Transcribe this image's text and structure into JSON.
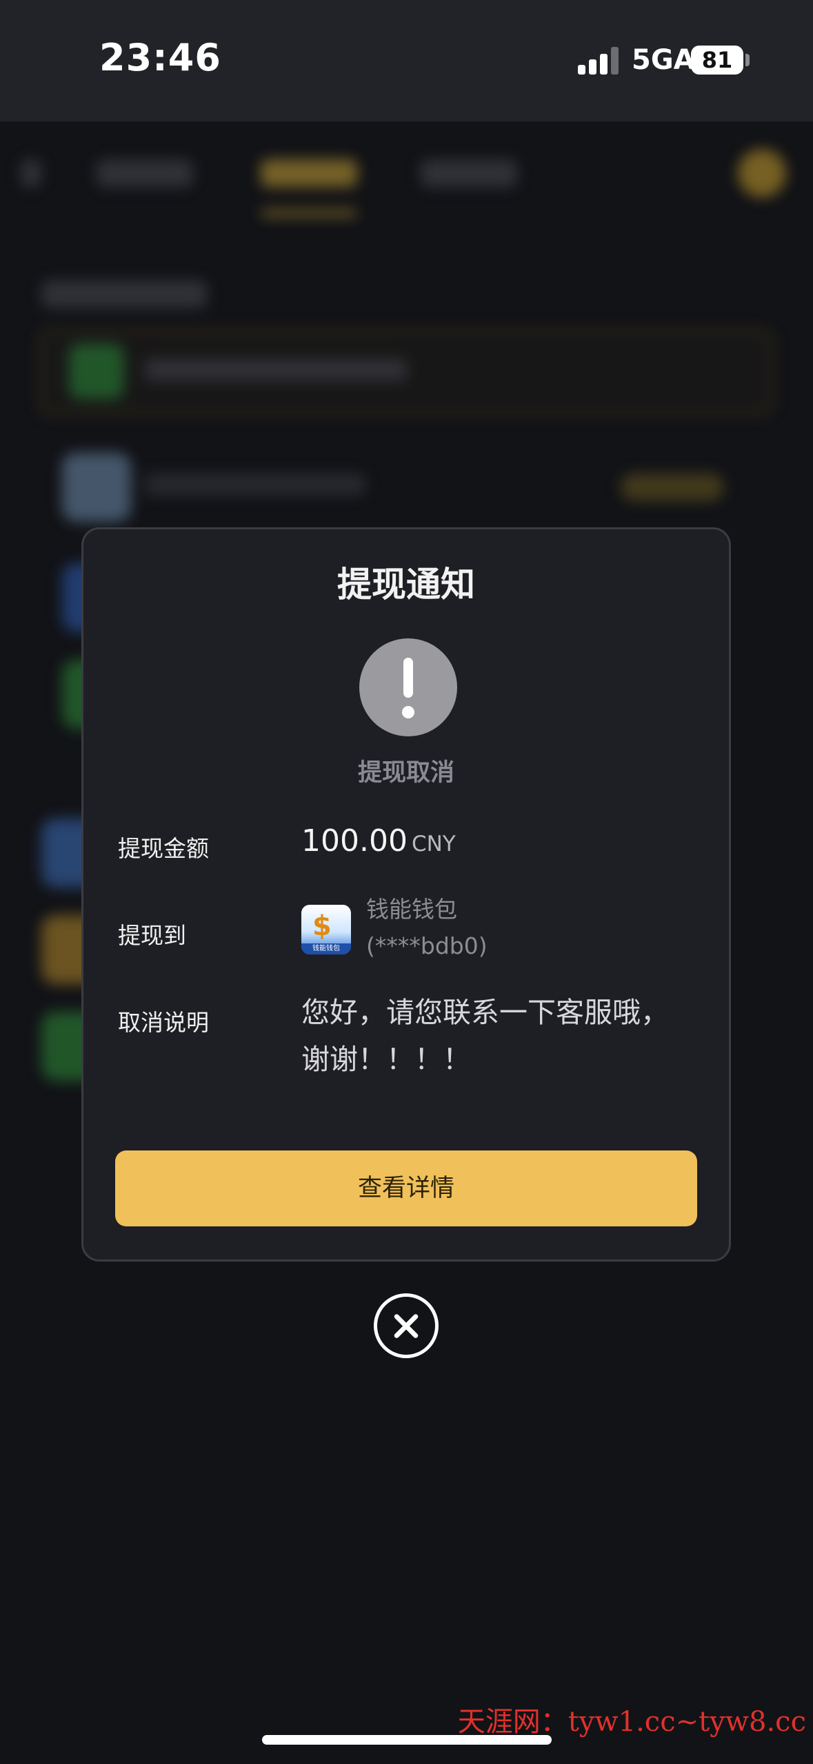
{
  "status_bar": {
    "time": "23:46",
    "network": "5GA",
    "battery": "81"
  },
  "modal": {
    "title": "提现通知",
    "status": "提现取消",
    "amount_label": "提现金额",
    "amount_value": "100.00",
    "currency": "CNY",
    "to_label": "提现到",
    "wallet_name": "钱能钱包",
    "wallet_account": "(****bdb0)",
    "wallet_icon_glyph": "$",
    "wallet_icon_caption": "钱能钱包",
    "cancel_label": "取消说明",
    "cancel_note": "您好，请您联系一下客服哦，谢谢！！！！",
    "detail_button": "查看详情"
  },
  "watermark": "天涯网：tyw1.cc~tyw8.cc",
  "colors": {
    "accent": "#f0c05a",
    "modal_bg": "#1e1f24",
    "status_grey": "#9b9b9f"
  },
  "icons": {
    "alert": "exclamation-circle-icon",
    "close": "close-circle-icon",
    "wallet": "wallet-app-icon"
  }
}
